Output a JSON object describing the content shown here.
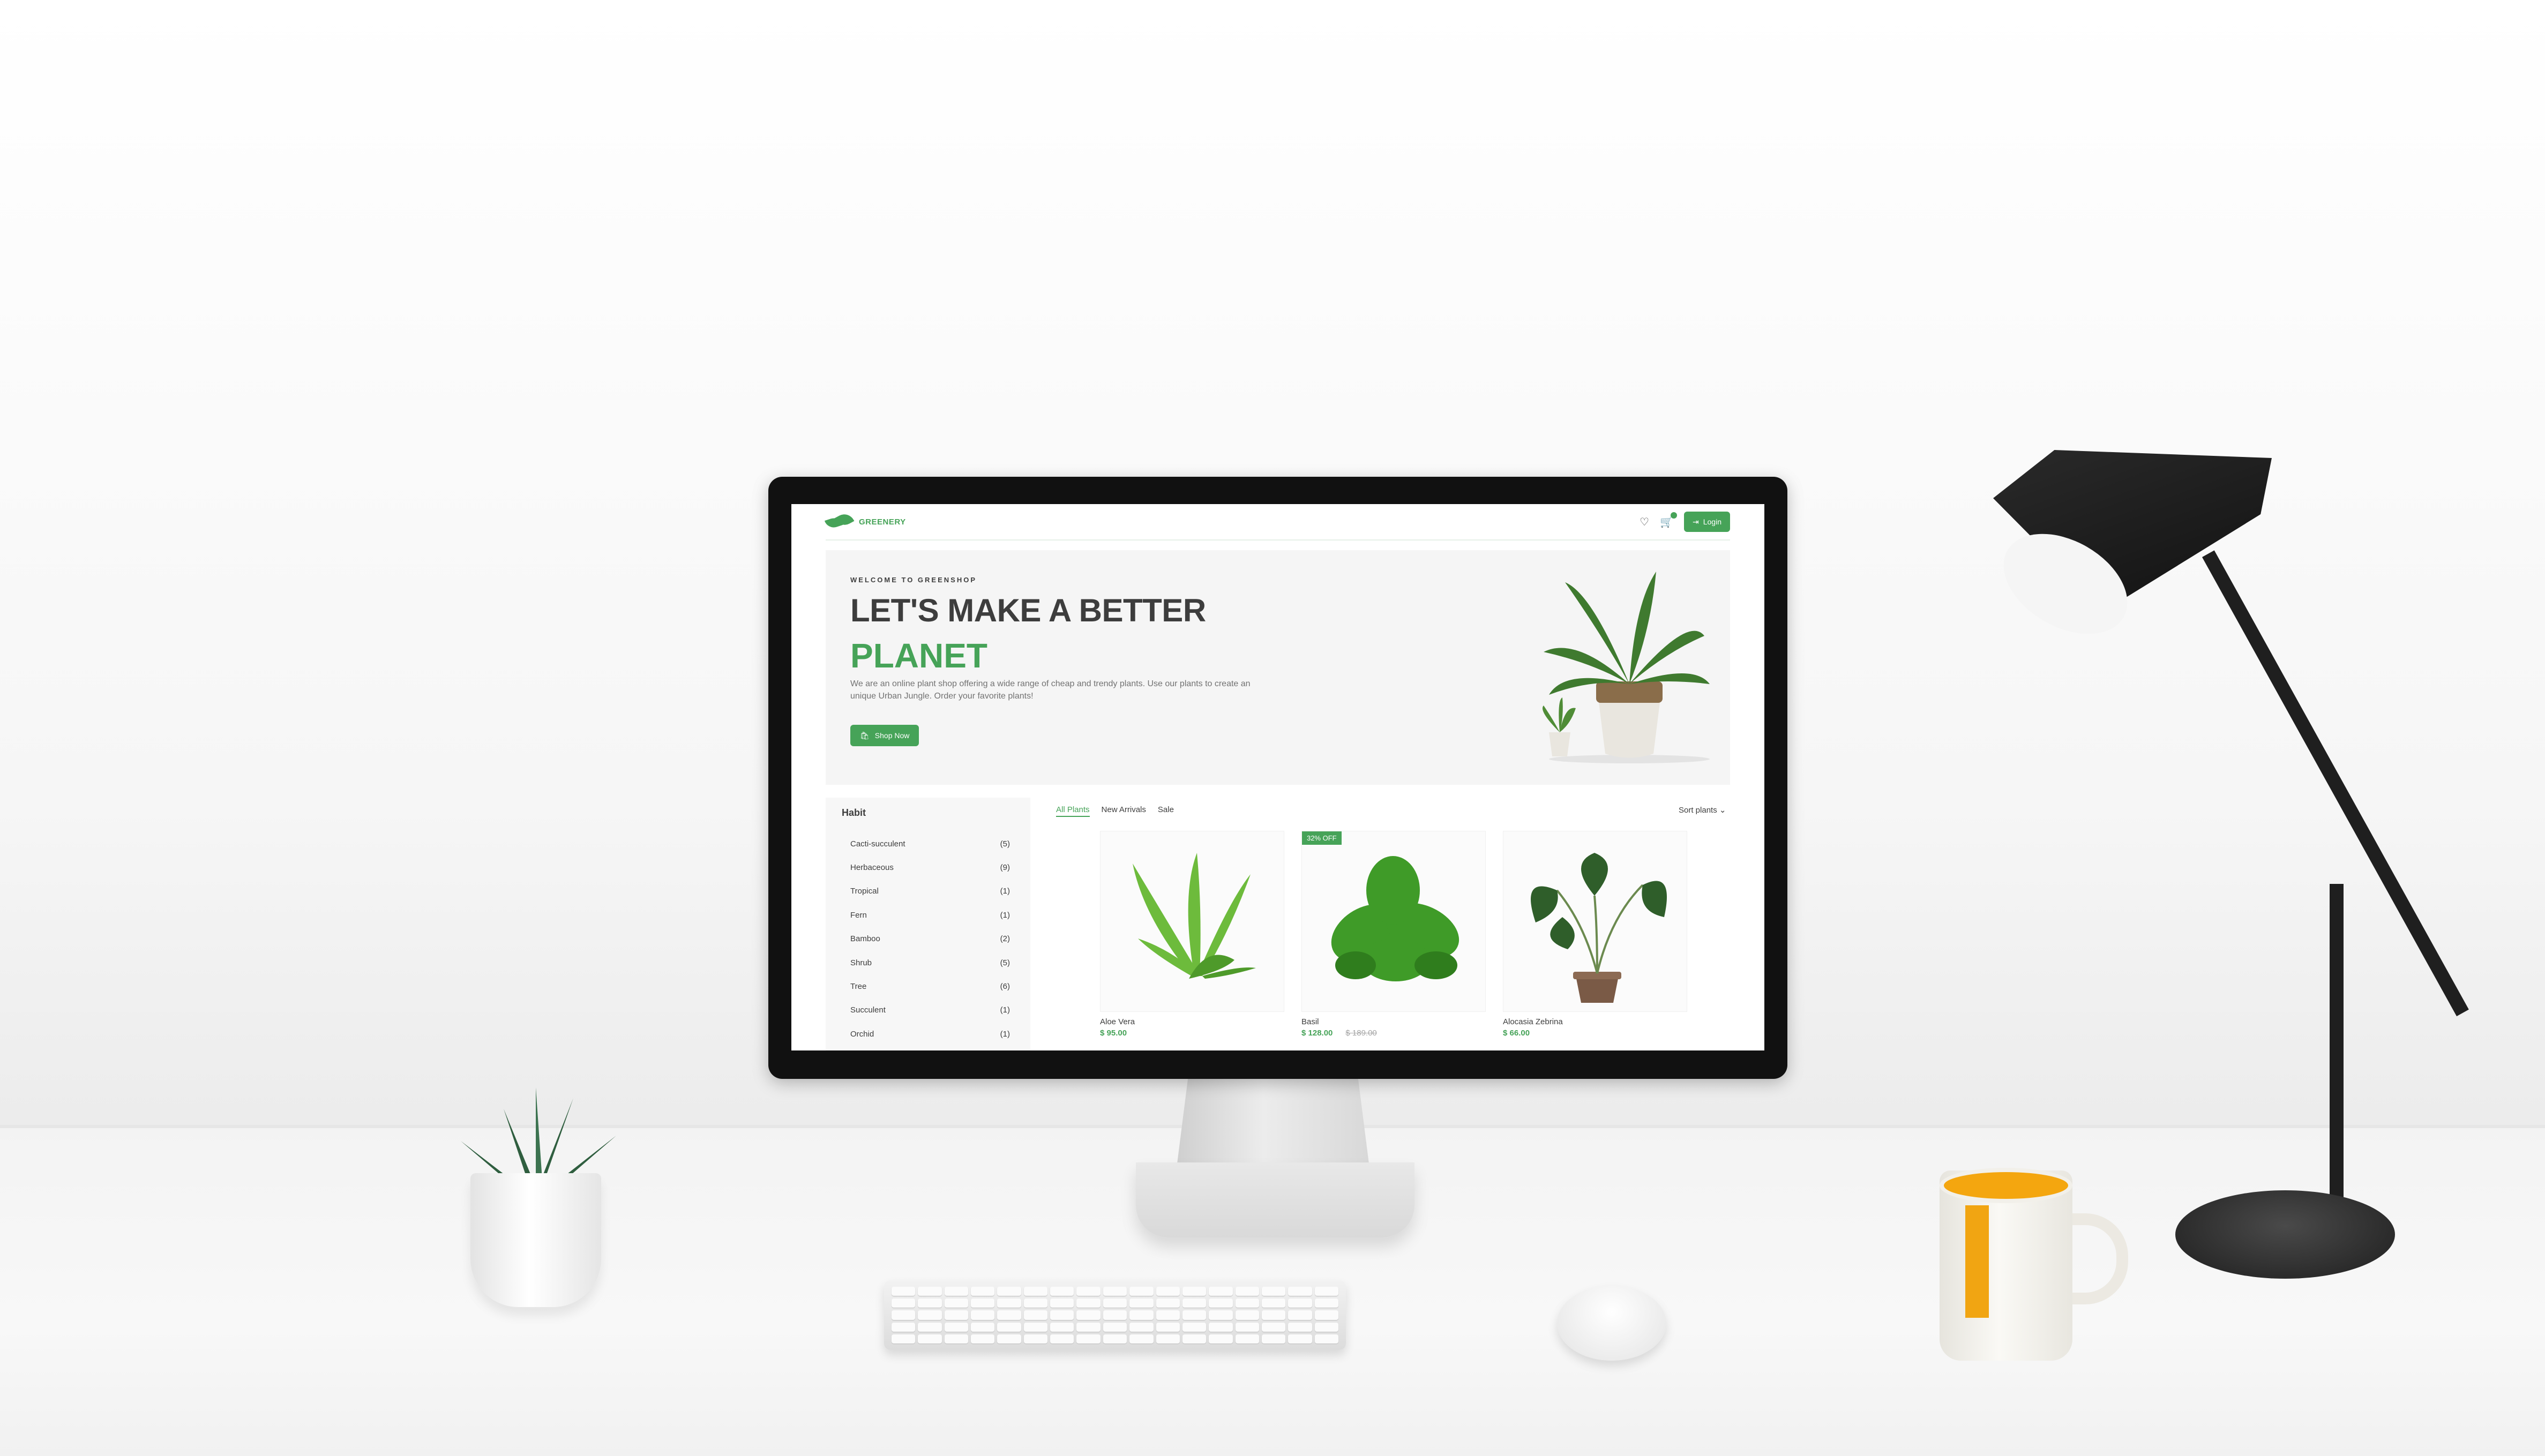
{
  "header": {
    "brand": "GREENERY",
    "login_label": "Login"
  },
  "hero": {
    "kicker": "WELCOME TO GREENSHOP",
    "title_line1": "LET'S MAKE A BETTER",
    "title_line2": "PLANET",
    "description": "We are an online plant shop offering a wide range of cheap and trendy plants. Use our plants to create an unique Urban Jungle. Order your favorite plants!",
    "cta_label": "Shop Now"
  },
  "sidebar": {
    "title": "Habit",
    "items": [
      {
        "label": "Cacti-succulent",
        "count": "(5)"
      },
      {
        "label": "Herbaceous",
        "count": "(9)"
      },
      {
        "label": "Tropical",
        "count": "(1)"
      },
      {
        "label": "Fern",
        "count": "(1)"
      },
      {
        "label": "Bamboo",
        "count": "(2)"
      },
      {
        "label": "Shrub",
        "count": "(5)"
      },
      {
        "label": "Tree",
        "count": "(6)"
      },
      {
        "label": "Succulent",
        "count": "(1)"
      },
      {
        "label": "Orchid",
        "count": "(1)"
      }
    ]
  },
  "tabs": {
    "all": "All Plants",
    "new": "New Arrivals",
    "sale": "Sale",
    "sort_label": "Sort plants"
  },
  "products": [
    {
      "name": "Aloe Vera",
      "price": "$ 95.00",
      "old_price": "",
      "badge": ""
    },
    {
      "name": "Basil",
      "price": "$ 128.00",
      "old_price": "$ 189.00",
      "badge": "32% OFF"
    },
    {
      "name": "Alocasia Zebrina",
      "price": "$ 66.00",
      "old_price": "",
      "badge": ""
    }
  ],
  "theme": {
    "accent": "#46a358",
    "text": "#3d3d3d"
  },
  "icons": [
    "heart-icon",
    "cart-icon",
    "login-icon",
    "shopping-bag-icon",
    "chevron-down-icon",
    "leaf-logo-icon"
  ]
}
